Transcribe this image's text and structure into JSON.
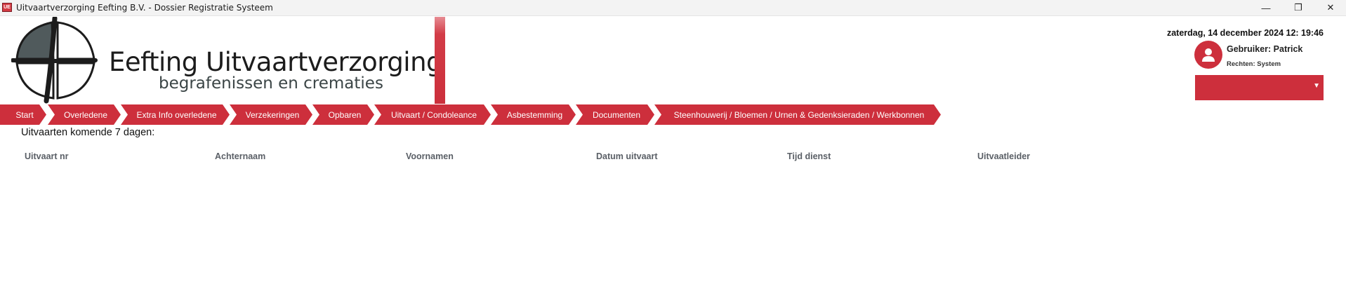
{
  "window": {
    "title": "Uitvaartverzorging Eefting B.V. - Dossier Registratie Systeem",
    "controls": {
      "minimize": "—",
      "maximize": "❐",
      "close": "✕"
    }
  },
  "logo": {
    "title": "Eefting Uitvaartverzorging",
    "subtitle": "begrafenissen en crematies"
  },
  "header": {
    "datetime": "zaterdag, 14 december 2024 12: 19:46",
    "user_label": "Gebruiker: Patrick",
    "rights_label": "Rechten: System",
    "select_value": ""
  },
  "nav": {
    "items": [
      "Start",
      "Overledene",
      "Extra Info overledene",
      "Verzekeringen",
      "Opbaren",
      "Uitvaart / Condoleance",
      "Asbestemming",
      "Documenten",
      "Steenhouwerij / Bloemen / Urnen & Gedenksieraden / Werkbonnen"
    ]
  },
  "main": {
    "heading": "Uitvaarten komende 7 dagen:",
    "columns": [
      "Uitvaart nr",
      "Achternaam",
      "Voornamen",
      "Datum uitvaart",
      "Tijd dienst",
      "Uitvaatleider"
    ],
    "rows": []
  },
  "colors": {
    "accent": "#cd2f3c",
    "logo_dark": "#1c1c1c",
    "logo_fill": "#505a5c"
  },
  "icons": {
    "app": "app-icon",
    "user": "user-icon",
    "dropdown": "chevron-down-icon"
  }
}
